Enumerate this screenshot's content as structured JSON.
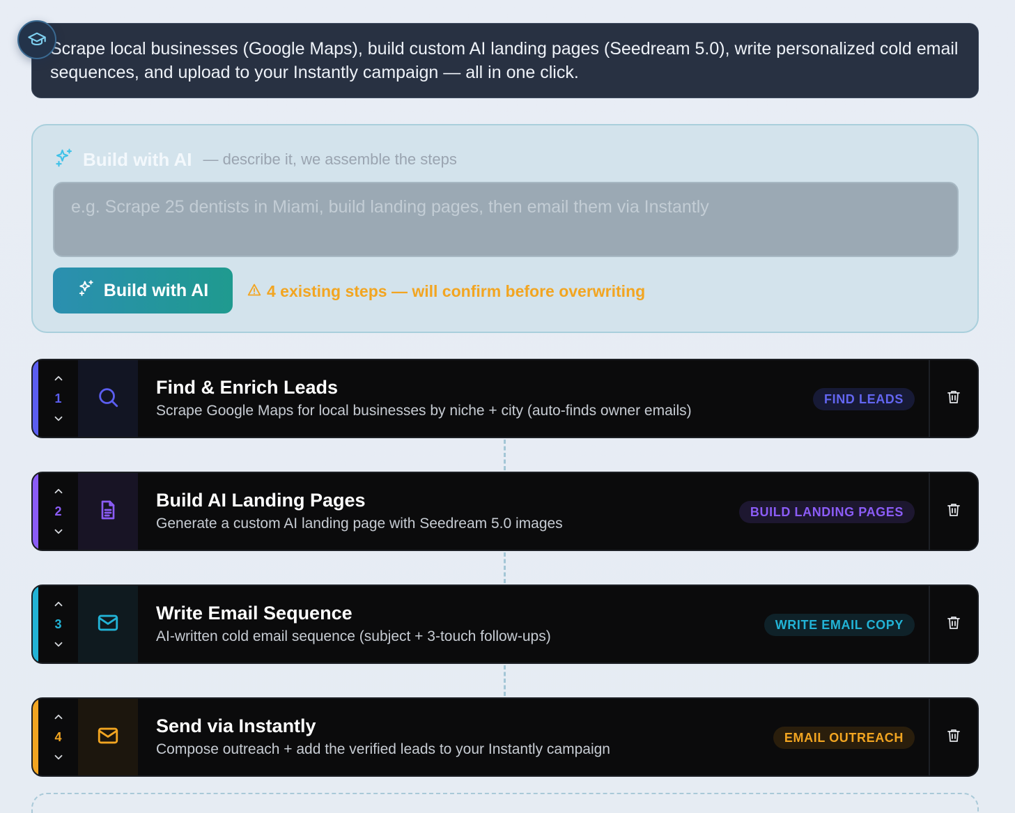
{
  "banner": {
    "text": "Scrape local businesses (Google Maps), build custom AI landing pages (Seedream 5.0), write personalized cold email sequences, and upload to your Instantly campaign — all in one click.",
    "badge_icon": "graduation-cap-icon"
  },
  "ai_builder": {
    "title": "Build with AI",
    "subtitle": "— describe it, we assemble the steps",
    "placeholder": "e.g. Scrape 25 dentists in Miami, build landing pages, then email them via Instantly",
    "button_label": "Build with AI",
    "warning": "4 existing steps — will confirm before overwriting",
    "accent_color": "#2b8fb0",
    "warning_color": "#f2a521"
  },
  "steps": [
    {
      "number": "1",
      "title": "Find & Enrich Leads",
      "description": "Scrape Google Maps for local businesses by niche + city (auto-finds owner emails)",
      "badge": "FIND LEADS",
      "icon": "search-icon",
      "color": "#5b5ef0"
    },
    {
      "number": "2",
      "title": "Build AI Landing Pages",
      "description": "Generate a custom AI landing page with Seedream 5.0 images",
      "badge": "BUILD LANDING PAGES",
      "icon": "document-icon",
      "color": "#8b5cf6"
    },
    {
      "number": "3",
      "title": "Write Email Sequence",
      "description": "AI-written cold email sequence (subject + 3-touch follow-ups)",
      "badge": "WRITE EMAIL COPY",
      "icon": "mail-icon",
      "color": "#22b3d6"
    },
    {
      "number": "4",
      "title": "Send via Instantly",
      "description": "Compose outreach + add the verified leads to your Instantly campaign",
      "badge": "EMAIL OUTREACH",
      "icon": "mail-icon",
      "color": "#f2a521"
    }
  ]
}
